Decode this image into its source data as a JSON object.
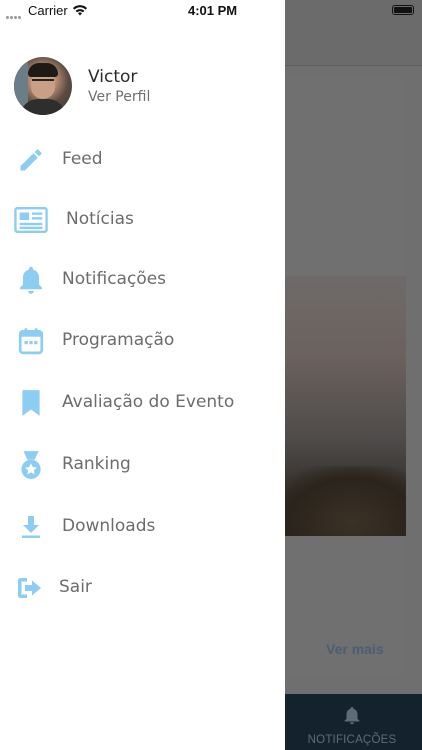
{
  "status_bar": {
    "carrier": "Carrier",
    "time": "4:01 PM"
  },
  "profile": {
    "name": "Victor",
    "subtitle": "Ver Perfil"
  },
  "menu": {
    "items": [
      {
        "label": "Feed",
        "icon": "pencil-icon"
      },
      {
        "label": "Notícias",
        "icon": "newspaper-icon"
      },
      {
        "label": "Notificações",
        "icon": "bell-icon"
      },
      {
        "label": "Programação",
        "icon": "calendar-icon"
      },
      {
        "label": "Avaliação do Evento",
        "icon": "bookmark-icon"
      },
      {
        "label": "Ranking",
        "icon": "medal-icon"
      },
      {
        "label": "Downloads",
        "icon": "download-icon"
      },
      {
        "label": "Sair",
        "icon": "logout-icon"
      }
    ]
  },
  "background": {
    "card_link": "Ver mais",
    "tab_label": "NOTIFICAÇÕES"
  },
  "colors": {
    "accent": "#8dcdf2",
    "drawer_bg": "#ffffff",
    "overlay": "#6f6f6f",
    "tabbar": "#14222e"
  }
}
